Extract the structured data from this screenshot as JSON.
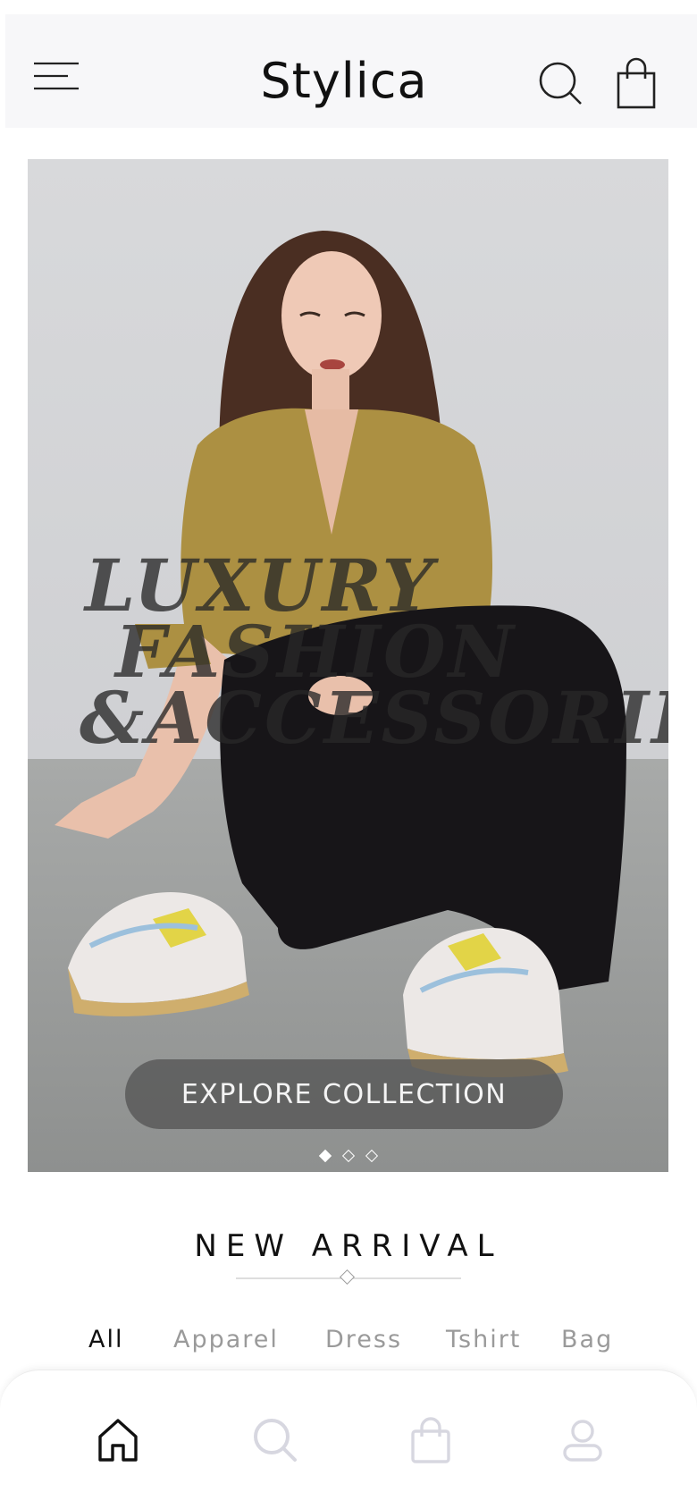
{
  "header": {
    "brand": "Stylica",
    "icons": [
      "menu-icon",
      "search-icon",
      "shopping-bag-icon"
    ]
  },
  "hero": {
    "headline_line1": "LUXURY",
    "headline_line2": "FASHION",
    "headline_line3": "&ACCESSORIES",
    "cta_label": "EXPLORE COLLECTION",
    "slides_total": 3,
    "active_slide": 1
  },
  "new_arrival": {
    "title": "NEW ARRIVAL",
    "filters": [
      "All",
      "Apparel",
      "Dress",
      "Tshirt",
      "Bag"
    ],
    "active_filter": "All"
  },
  "bottom_nav": {
    "items": [
      "home-icon",
      "search-icon",
      "shopping-bag-icon",
      "profile-icon"
    ],
    "active": "home-icon"
  },
  "colors": {
    "header_bg": "#f7f7f9",
    "text_primary": "#111111",
    "text_muted": "#9a9a9a",
    "cta_bg": "#555555",
    "nav_inactive": "#d7d7e0"
  }
}
